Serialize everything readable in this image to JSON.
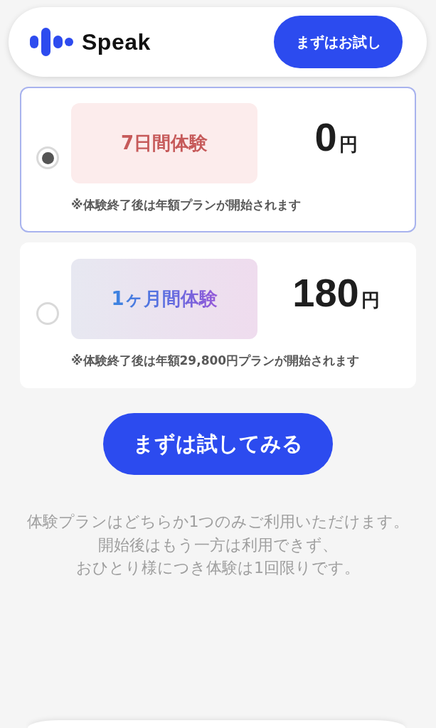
{
  "header": {
    "logo_text": "Speak",
    "button": "まずはお試し"
  },
  "plans": [
    {
      "kind": "plain",
      "selected": true,
      "label": "7日間体験",
      "price": "0",
      "currency": "円",
      "note": "※体験終了後は年額プランが開始されます"
    },
    {
      "kind": "gradient",
      "selected": false,
      "label": "1ヶ月間体験",
      "price": "180",
      "currency": "円",
      "note": "※体験終了後は年額29,800円プランが開始されます"
    }
  ],
  "cta_button": "まずは試してみる",
  "notice_lines": [
    "体験プランはどちらか1つのみご利用いただけます。",
    "開始後はもう一方は利用できず、",
    "おひとり様につき体験は1回限りです。"
  ]
}
